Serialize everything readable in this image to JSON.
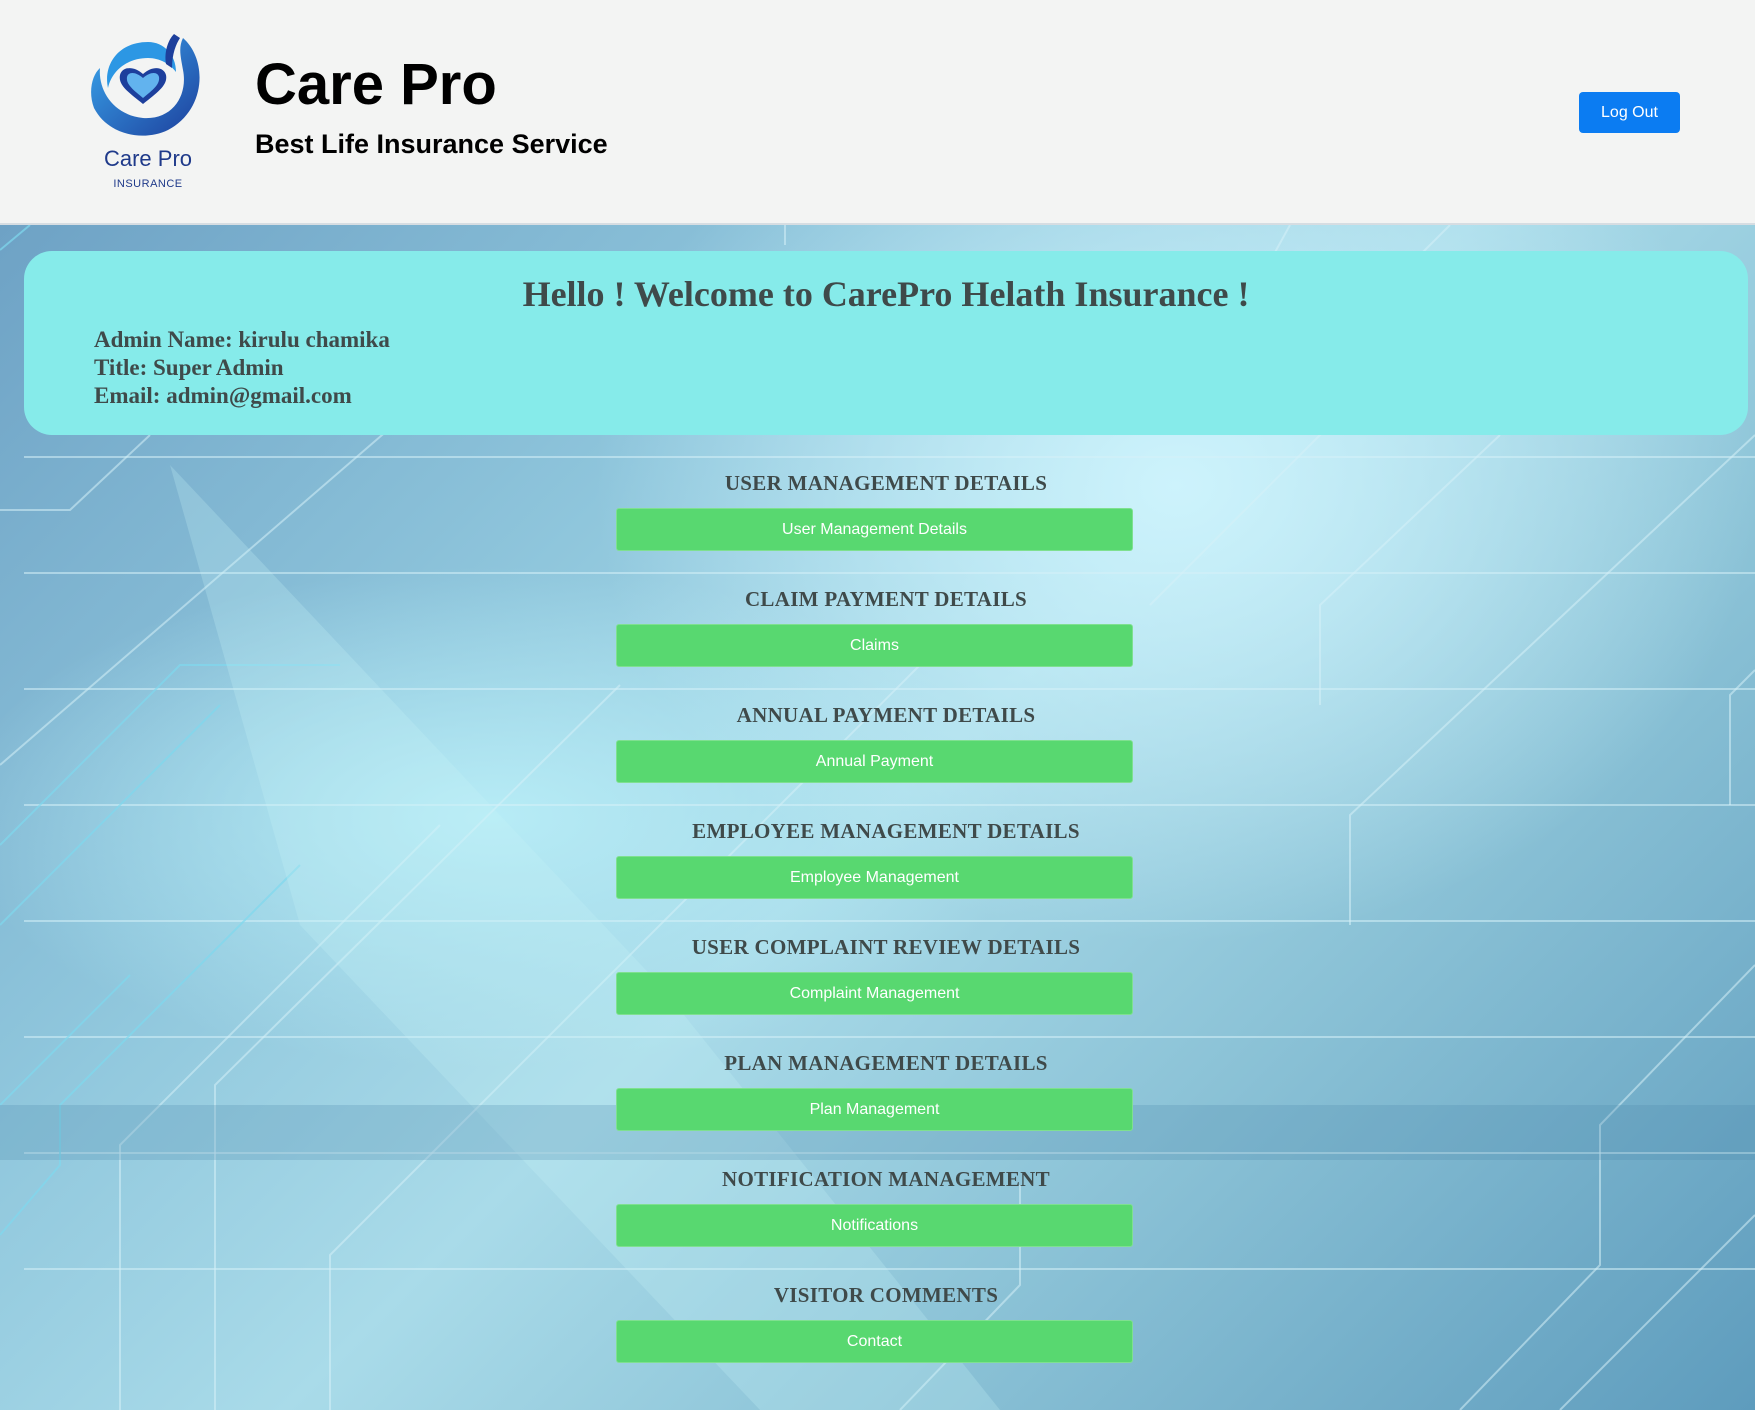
{
  "header": {
    "logo_name": "Care Pro",
    "logo_subtitle": "INSURANCE",
    "brand_title": "Care Pro",
    "brand_subtitle": "Best Life Insurance Service",
    "logout_label": "Log Out"
  },
  "welcome": {
    "title": "Hello ! Welcome to CarePro Helath Insurance !",
    "admin_name": "Admin Name: kirulu chamika",
    "admin_title": "Title: Super Admin",
    "admin_email": "Email: admin@gmail.com"
  },
  "sections": [
    {
      "heading": "USER MANAGEMENT DETAILS",
      "button": "User Management Details"
    },
    {
      "heading": "CLAIM PAYMENT DETAILS",
      "button": "Claims"
    },
    {
      "heading": "ANNUAL PAYMENT DETAILS",
      "button": "Annual Payment"
    },
    {
      "heading": "EMPLOYEE MANAGEMENT DETAILS",
      "button": "Employee Management"
    },
    {
      "heading": "USER COMPLAINT REVIEW DETAILS",
      "button": "Complaint Management"
    },
    {
      "heading": "PLAN MANAGEMENT DETAILS",
      "button": "Plan Management"
    },
    {
      "heading": "NOTIFICATION MANAGEMENT",
      "button": "Notifications"
    },
    {
      "heading": "VISITOR COMMENTS",
      "button": "Contact"
    }
  ],
  "colors": {
    "header_bg": "#f3f4f3",
    "logout_button": "#0b7cf2",
    "welcome_card": "#86ebea",
    "section_button": "#58d870",
    "heading_text": "#3f4a4a"
  },
  "icons": {
    "logo": "heart-hands-logo-icon"
  }
}
